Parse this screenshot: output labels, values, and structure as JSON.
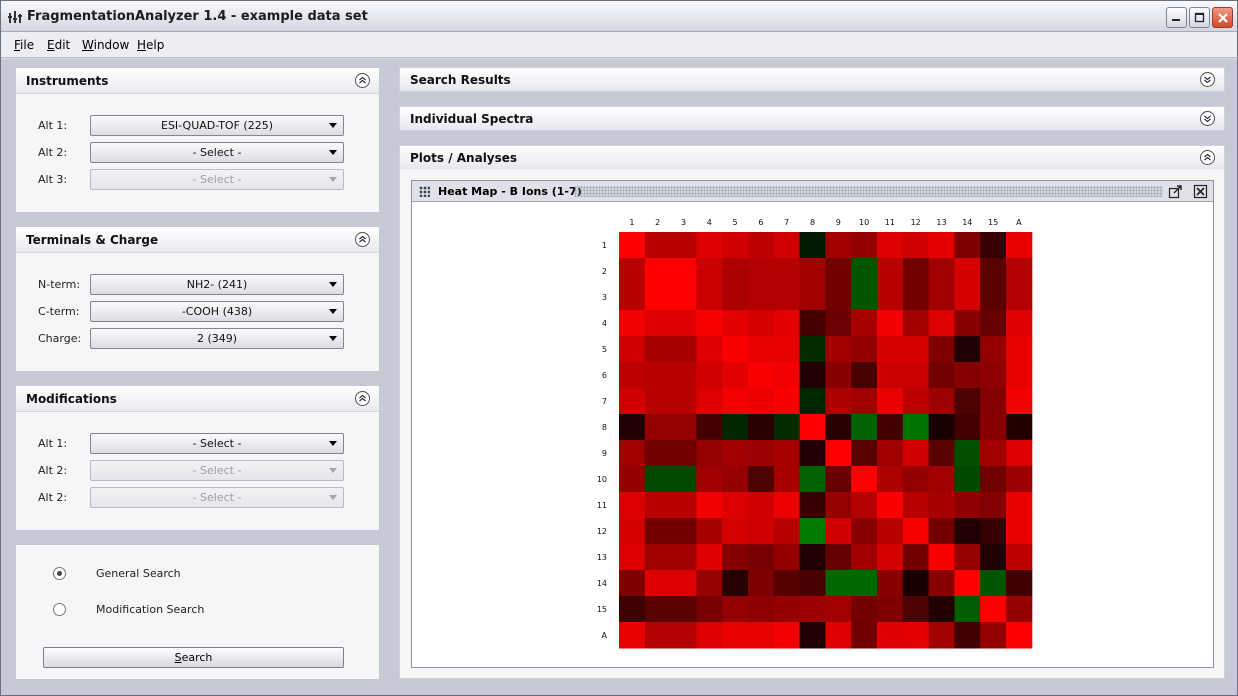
{
  "window": {
    "title": "FragmentationAnalyzer 1.4 - example data set"
  },
  "menu": [
    {
      "label": "File",
      "mnemonic": "F",
      "rest": "ile"
    },
    {
      "label": "Edit",
      "mnemonic": "E",
      "rest": "dit"
    },
    {
      "label": "Window",
      "mnemonic": "W",
      "rest": "indow"
    },
    {
      "label": "Help",
      "mnemonic": "H",
      "rest": "elp"
    }
  ],
  "instruments": {
    "title": "Instruments",
    "fields": [
      {
        "label": "Alt 1:",
        "value": "ESI-QUAD-TOF (225)",
        "enabled": true
      },
      {
        "label": "Alt 2:",
        "value": "- Select -",
        "enabled": true
      },
      {
        "label": "Alt 3:",
        "value": "- Select -",
        "enabled": false
      }
    ]
  },
  "terminals": {
    "title": "Terminals & Charge",
    "fields": [
      {
        "label": "N-term:",
        "value": "NH2- (241)",
        "enabled": true
      },
      {
        "label": "C-term:",
        "value": "-COOH (438)",
        "enabled": true
      },
      {
        "label": "Charge:",
        "value": "2 (349)",
        "enabled": true
      }
    ]
  },
  "modifications": {
    "title": "Modifications",
    "fields": [
      {
        "label": "Alt 1:",
        "value": "- Select -",
        "enabled": true
      },
      {
        "label": "Alt 2:",
        "value": "- Select -",
        "enabled": false
      },
      {
        "label": "Alt 2:",
        "value": "- Select -",
        "enabled": false
      }
    ]
  },
  "search_type": {
    "options": [
      {
        "label": "General Search",
        "selected": true
      },
      {
        "label": "Modification Search",
        "selected": false
      }
    ],
    "button_label": "Search",
    "button_mnemonic": "S",
    "button_rest": "earch"
  },
  "right_panels": {
    "search_results": "Search Results",
    "individual_spectra": "Individual Spectra",
    "plots_analyses": "Plots / Analyses"
  },
  "heatmap_frame": {
    "title": "Heat Map - B Ions (1-7)"
  },
  "colors": {
    "accent_red": "#ff0000",
    "accent_green": "#1a7a00",
    "panel_bg": "#f6f6f9",
    "window_bg": "#c7c9d6"
  },
  "chart_data": {
    "type": "heatmap",
    "x_labels": [
      "1",
      "2",
      "3",
      "4",
      "5",
      "6",
      "7",
      "8",
      "9",
      "10",
      "11",
      "12",
      "13",
      "14",
      "15",
      "A"
    ],
    "y_labels": [
      "1",
      "2",
      "3",
      "4",
      "5",
      "6",
      "7",
      "8",
      "9",
      "10",
      "11",
      "12",
      "13",
      "14",
      "15",
      "A"
    ],
    "color_scale": "green-black-red",
    "values": [
      [
        1.0,
        0.7,
        0.7,
        0.85,
        0.8,
        0.72,
        0.8,
        -0.05,
        0.6,
        0.55,
        0.85,
        0.8,
        0.88,
        0.45,
        0.15,
        0.9
      ],
      [
        0.7,
        1.0,
        1.0,
        0.78,
        0.65,
        0.68,
        0.68,
        0.6,
        0.4,
        -0.55,
        0.7,
        0.4,
        0.6,
        0.82,
        0.3,
        0.68
      ],
      [
        0.7,
        1.0,
        1.0,
        0.78,
        0.65,
        0.68,
        0.68,
        0.6,
        0.4,
        -0.55,
        0.7,
        0.4,
        0.6,
        0.82,
        0.3,
        0.68
      ],
      [
        0.95,
        0.85,
        0.85,
        0.97,
        0.88,
        0.82,
        0.88,
        0.2,
        0.38,
        0.62,
        0.95,
        0.6,
        0.85,
        0.5,
        0.35,
        0.85
      ],
      [
        0.8,
        0.62,
        0.62,
        0.85,
        0.98,
        0.9,
        0.9,
        -0.2,
        0.6,
        0.55,
        0.82,
        0.82,
        0.45,
        0.05,
        0.55,
        0.9
      ],
      [
        0.72,
        0.7,
        0.7,
        0.8,
        0.88,
        0.98,
        0.95,
        0.05,
        0.5,
        0.22,
        0.78,
        0.78,
        0.4,
        0.48,
        0.52,
        0.9
      ],
      [
        0.8,
        0.7,
        0.7,
        0.85,
        0.95,
        0.92,
        0.98,
        -0.15,
        0.65,
        0.6,
        0.9,
        0.72,
        0.58,
        0.25,
        0.48,
        0.95
      ],
      [
        0.05,
        0.55,
        0.55,
        0.2,
        -0.15,
        0.1,
        -0.2,
        1.0,
        0.08,
        -0.65,
        0.2,
        -0.8,
        0.02,
        0.2,
        0.5,
        0.06
      ],
      [
        0.6,
        0.4,
        0.4,
        0.55,
        0.6,
        0.58,
        0.62,
        0.05,
        1.0,
        0.3,
        0.6,
        0.8,
        0.3,
        -0.5,
        0.6,
        0.85
      ],
      [
        0.55,
        -0.45,
        -0.45,
        0.6,
        0.55,
        0.25,
        0.62,
        -0.65,
        0.35,
        1.0,
        0.65,
        0.55,
        0.6,
        -0.45,
        0.4,
        0.58
      ],
      [
        0.85,
        0.7,
        0.7,
        0.95,
        0.85,
        0.8,
        0.92,
        0.15,
        0.55,
        0.68,
        0.98,
        0.7,
        0.62,
        0.52,
        0.48,
        0.9
      ],
      [
        0.82,
        0.4,
        0.4,
        0.62,
        0.82,
        0.8,
        0.7,
        -0.85,
        0.8,
        0.5,
        0.7,
        0.98,
        0.4,
        0.05,
        0.15,
        0.9
      ],
      [
        0.85,
        0.6,
        0.6,
        0.85,
        0.48,
        0.42,
        0.55,
        0.05,
        0.35,
        0.6,
        0.82,
        0.4,
        0.98,
        0.55,
        0.05,
        0.72
      ],
      [
        0.45,
        0.85,
        0.85,
        0.55,
        0.08,
        0.45,
        0.28,
        0.22,
        -0.7,
        -0.7,
        0.5,
        0.02,
        0.5,
        1.0,
        -0.55,
        0.18
      ],
      [
        0.18,
        0.3,
        0.3,
        0.42,
        0.55,
        0.52,
        0.55,
        0.58,
        0.6,
        0.4,
        0.45,
        0.25,
        0.05,
        -0.6,
        1.0,
        0.55
      ],
      [
        0.9,
        0.68,
        0.68,
        0.85,
        0.9,
        0.9,
        0.95,
        0.05,
        0.85,
        0.4,
        0.85,
        0.88,
        0.6,
        0.2,
        0.55,
        1.0
      ]
    ]
  }
}
